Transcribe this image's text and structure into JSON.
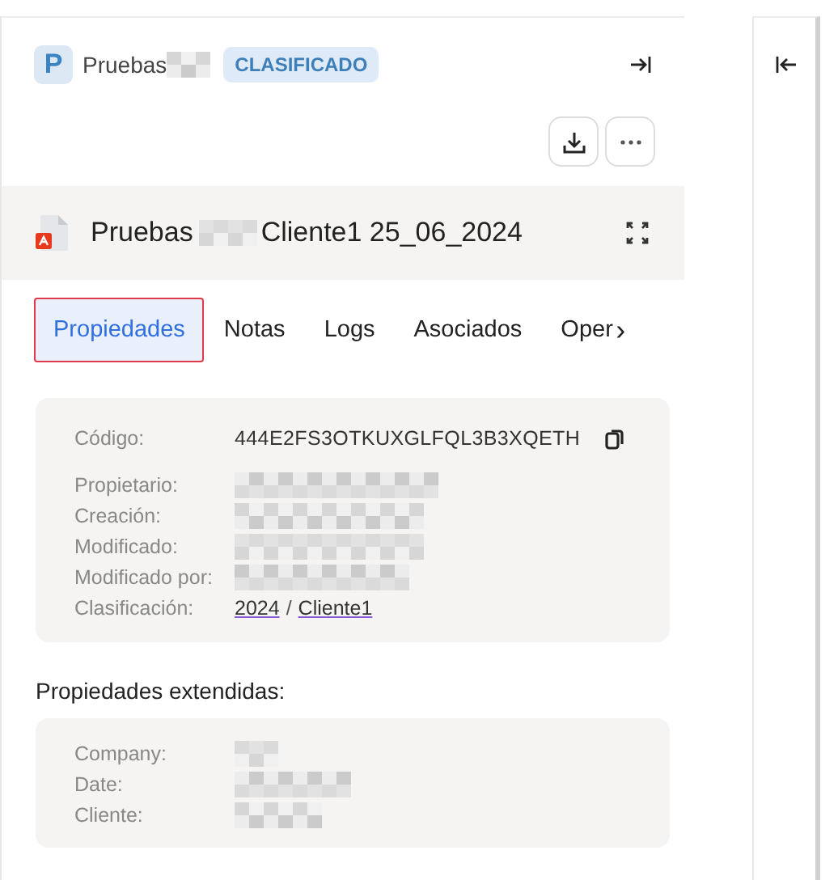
{
  "header": {
    "avatar": "P",
    "title": "Pruebas",
    "title_redacted": true,
    "badge": "CLASIFICADO"
  },
  "document": {
    "name_start": "Pruebas",
    "name_end": "Cliente1 25_06_2024",
    "name_redacted": true
  },
  "tabs": [
    {
      "label": "Propiedades",
      "selected": true
    },
    {
      "label": "Notas",
      "selected": false
    },
    {
      "label": "Logs",
      "selected": false
    },
    {
      "label": "Asociados",
      "selected": false
    },
    {
      "label": "Oper",
      "selected": false
    }
  ],
  "tab_scroll": "›",
  "properties": [
    {
      "label": "Código:",
      "kind": "code",
      "value": "444E2FS3OTKUXGLFQL3B3XQETH"
    },
    {
      "label": "Propietario:",
      "kind": "redacted"
    },
    {
      "label": "Creación:",
      "kind": "redacted"
    },
    {
      "label": "Modificado:",
      "kind": "redacted"
    },
    {
      "label": "Modificado por:",
      "kind": "redacted"
    },
    {
      "label": "Clasificación:",
      "kind": "links",
      "links": [
        "2024",
        "Cliente1"
      ],
      "separator": "/"
    }
  ],
  "extended_title": "Propiedades extendidas:",
  "extended": [
    {
      "label": "Company:",
      "kind": "redacted"
    },
    {
      "label": "Date:",
      "kind": "redacted"
    },
    {
      "label": "Cliente:",
      "kind": "redacted"
    }
  ]
}
